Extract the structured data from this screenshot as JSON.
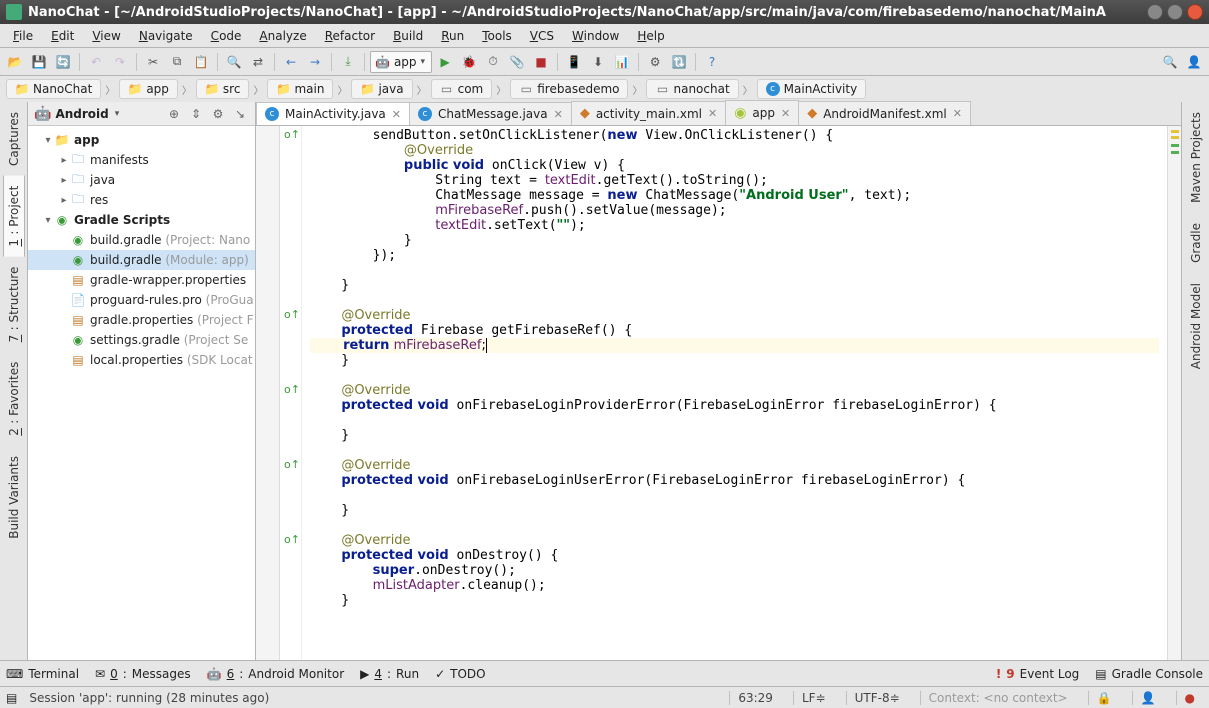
{
  "title": "NanoChat - [~/AndroidStudioProjects/NanoChat] - [app] - ~/AndroidStudioProjects/NanoChat/app/src/main/java/com/firebasedemo/nanochat/MainA",
  "menu": [
    "File",
    "Edit",
    "View",
    "Navigate",
    "Code",
    "Analyze",
    "Refactor",
    "Build",
    "Run",
    "Tools",
    "VCS",
    "Window",
    "Help"
  ],
  "run_config": "app",
  "breadcrumb": [
    {
      "icon": "folder",
      "label": "NanoChat"
    },
    {
      "icon": "module",
      "label": "app"
    },
    {
      "icon": "folder",
      "label": "src"
    },
    {
      "icon": "folder",
      "label": "main"
    },
    {
      "icon": "folder",
      "label": "java"
    },
    {
      "icon": "package",
      "label": "com"
    },
    {
      "icon": "package",
      "label": "firebasedemo"
    },
    {
      "icon": "package",
      "label": "nanochat"
    },
    {
      "icon": "class",
      "label": "MainActivity"
    }
  ],
  "left_rail": [
    {
      "label": "Captures",
      "active": false
    },
    {
      "num": "1",
      "label": "Project",
      "active": true
    },
    {
      "num": "7",
      "label": "Structure",
      "active": false
    },
    {
      "num": "2",
      "label": "Favorites",
      "active": false
    },
    {
      "label": "Build Variants",
      "active": false
    }
  ],
  "right_rail": [
    {
      "label": "Maven Projects"
    },
    {
      "label": "Gradle"
    },
    {
      "label": "Android Model"
    }
  ],
  "project_panel": {
    "view": "Android",
    "tree": [
      {
        "depth": 0,
        "expand": "▾",
        "icon": "module",
        "bold": true,
        "label": "app"
      },
      {
        "depth": 1,
        "expand": "▸",
        "icon": "folder-b",
        "label": "manifests"
      },
      {
        "depth": 1,
        "expand": "▸",
        "icon": "folder-b",
        "label": "java"
      },
      {
        "depth": 1,
        "expand": "▸",
        "icon": "folder-b",
        "label": "res"
      },
      {
        "depth": 0,
        "expand": "▾",
        "icon": "gradle",
        "bold": true,
        "label": "Gradle Scripts"
      },
      {
        "depth": 1,
        "icon": "gradle-f",
        "label": "build.gradle",
        "dim": "(Project: Nano"
      },
      {
        "depth": 1,
        "icon": "gradle-f",
        "label": "build.gradle",
        "dim": "(Module: app)",
        "selected": true
      },
      {
        "depth": 1,
        "icon": "prop",
        "label": "gradle-wrapper.properties"
      },
      {
        "depth": 1,
        "icon": "txt",
        "label": "proguard-rules.pro",
        "dim": "(ProGua"
      },
      {
        "depth": 1,
        "icon": "prop",
        "label": "gradle.properties",
        "dim": "(Project F"
      },
      {
        "depth": 1,
        "icon": "gradle-f",
        "label": "settings.gradle",
        "dim": "(Project Se"
      },
      {
        "depth": 1,
        "icon": "prop",
        "label": "local.properties",
        "dim": "(SDK Locat"
      }
    ]
  },
  "editor_tabs": [
    {
      "icon": "class",
      "label": "MainActivity.java",
      "active": true,
      "closable": true
    },
    {
      "icon": "class",
      "label": "ChatMessage.java",
      "closable": true
    },
    {
      "icon": "xml",
      "label": "activity_main.xml",
      "closable": true
    },
    {
      "icon": "module",
      "label": "app",
      "closable": true
    },
    {
      "icon": "xml",
      "label": "AndroidManifest.xml",
      "closable": true
    }
  ],
  "code": [
    "        sendButton.setOnClickListener(<kw>new</kw> View.OnClickListener() {",
    "            <ann>@Override</ann>",
    "            <kw>public void</kw> onClick(View v) {",
    "                String text = <fld>textEdit</fld>.getText().toString();",
    "                ChatMessage message = <kw>new</kw> ChatMessage(<str>\"Android User\"</str>, text);",
    "                <fld>mFirebaseRef</fld>.push().setValue(message);",
    "                <fld>textEdit</fld>.setText(<str>\"\"</str>);",
    "            }",
    "        });",
    "",
    "    }",
    "",
    "    <ann>@Override</ann>",
    "    <kw>protected</kw> Firebase getFirebaseRef() {",
    "        <kw>return</kw> <fld>mFirebaseRef</fld>;<caret>",
    "    }",
    "",
    "    <ann>@Override</ann>",
    "    <kw>protected void</kw> onFirebaseLoginProviderError(FirebaseLoginError firebaseLoginError) {",
    "",
    "    }",
    "",
    "    <ann>@Override</ann>",
    "    <kw>protected void</kw> onFirebaseLoginUserError(FirebaseLoginError firebaseLoginError) {",
    "",
    "    }",
    "",
    "    <ann>@Override</ann>",
    "    <kw>protected void</kw> onDestroy() {",
    "        <kw>super</kw>.onDestroy();",
    "        <fld>mListAdapter</fld>.cleanup();",
    "    }",
    "",
    ""
  ],
  "highlight_line": 14,
  "bottom": [
    {
      "icon": "terminal",
      "label": "Terminal"
    },
    {
      "icon": "msg",
      "num": "0",
      "label": "Messages"
    },
    {
      "icon": "android",
      "num": "6",
      "label": "Android Monitor"
    },
    {
      "icon": "run",
      "num": "4",
      "label": "Run"
    },
    {
      "icon": "todo",
      "label": "TODO"
    }
  ],
  "bottom_right": [
    {
      "icon": "event",
      "count": "9",
      "label": "Event Log"
    },
    {
      "icon": "gradle",
      "label": "Gradle Console"
    }
  ],
  "status": {
    "message": "Session 'app': running (28 minutes ago)",
    "pos": "63:29",
    "sep": "LF≑",
    "enc": "UTF-8≑",
    "ctx": "Context: <no context>"
  }
}
